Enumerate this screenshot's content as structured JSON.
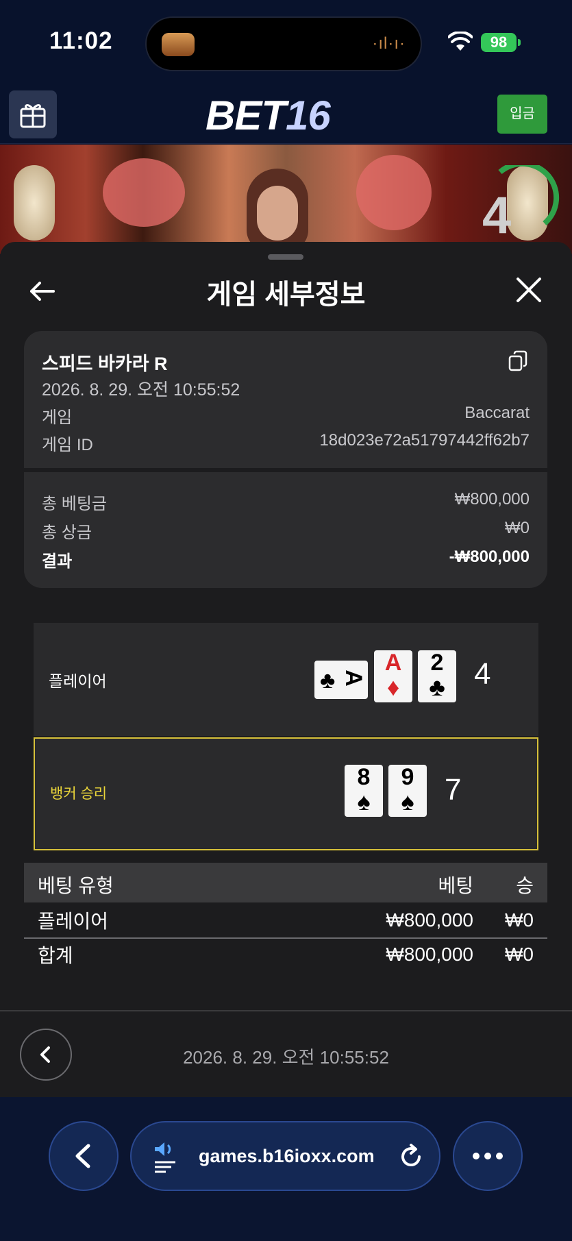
{
  "status": {
    "time": "11:02",
    "battery": "98"
  },
  "header": {
    "logo_part1": "BET",
    "logo_part2": "16",
    "deposit_label": "입금"
  },
  "video": {
    "countdown": "4"
  },
  "sheet": {
    "title": "게임 세부정보",
    "game_name": "스피드 바카라 R",
    "game_datetime": "2026. 8. 29. 오전 10:55:52",
    "rows": [
      {
        "label": "게임",
        "value": "Baccarat"
      },
      {
        "label": "게임 ID",
        "value": "18d023e72a51797442ff62b7"
      }
    ],
    "totals": [
      {
        "label": "총 베팅금",
        "value": "₩800,000"
      },
      {
        "label": "총 상금",
        "value": "₩0"
      },
      {
        "label": "결과",
        "value": "-₩800,000"
      }
    ],
    "player": {
      "label": "플레이어",
      "score": "4",
      "cards": [
        {
          "rank": "A",
          "suit": "♣",
          "color": "black"
        },
        {
          "rank": "A",
          "suit": "♦",
          "color": "red"
        },
        {
          "rank": "2",
          "suit": "♣",
          "color": "black"
        }
      ]
    },
    "banker": {
      "label": "뱅커 승리",
      "score": "7",
      "cards": [
        {
          "rank": "8",
          "suit": "♠",
          "color": "black"
        },
        {
          "rank": "9",
          "suit": "♠",
          "color": "black"
        }
      ]
    },
    "bet_table": {
      "headers": [
        "베팅 유형",
        "베팅",
        "승"
      ],
      "rows": [
        [
          "플레이어",
          "₩800,000",
          "₩0"
        ],
        [
          "합계",
          "₩800,000",
          "₩0"
        ]
      ]
    },
    "footer_date": "2026. 8. 29. 오전 10:55:52"
  },
  "browser": {
    "url": "games.b16ioxx.com"
  },
  "colors": {
    "accent_green": "#2f9a3b",
    "winner_yellow": "#d7c13a",
    "sheet_bg": "#1c1c1e"
  }
}
